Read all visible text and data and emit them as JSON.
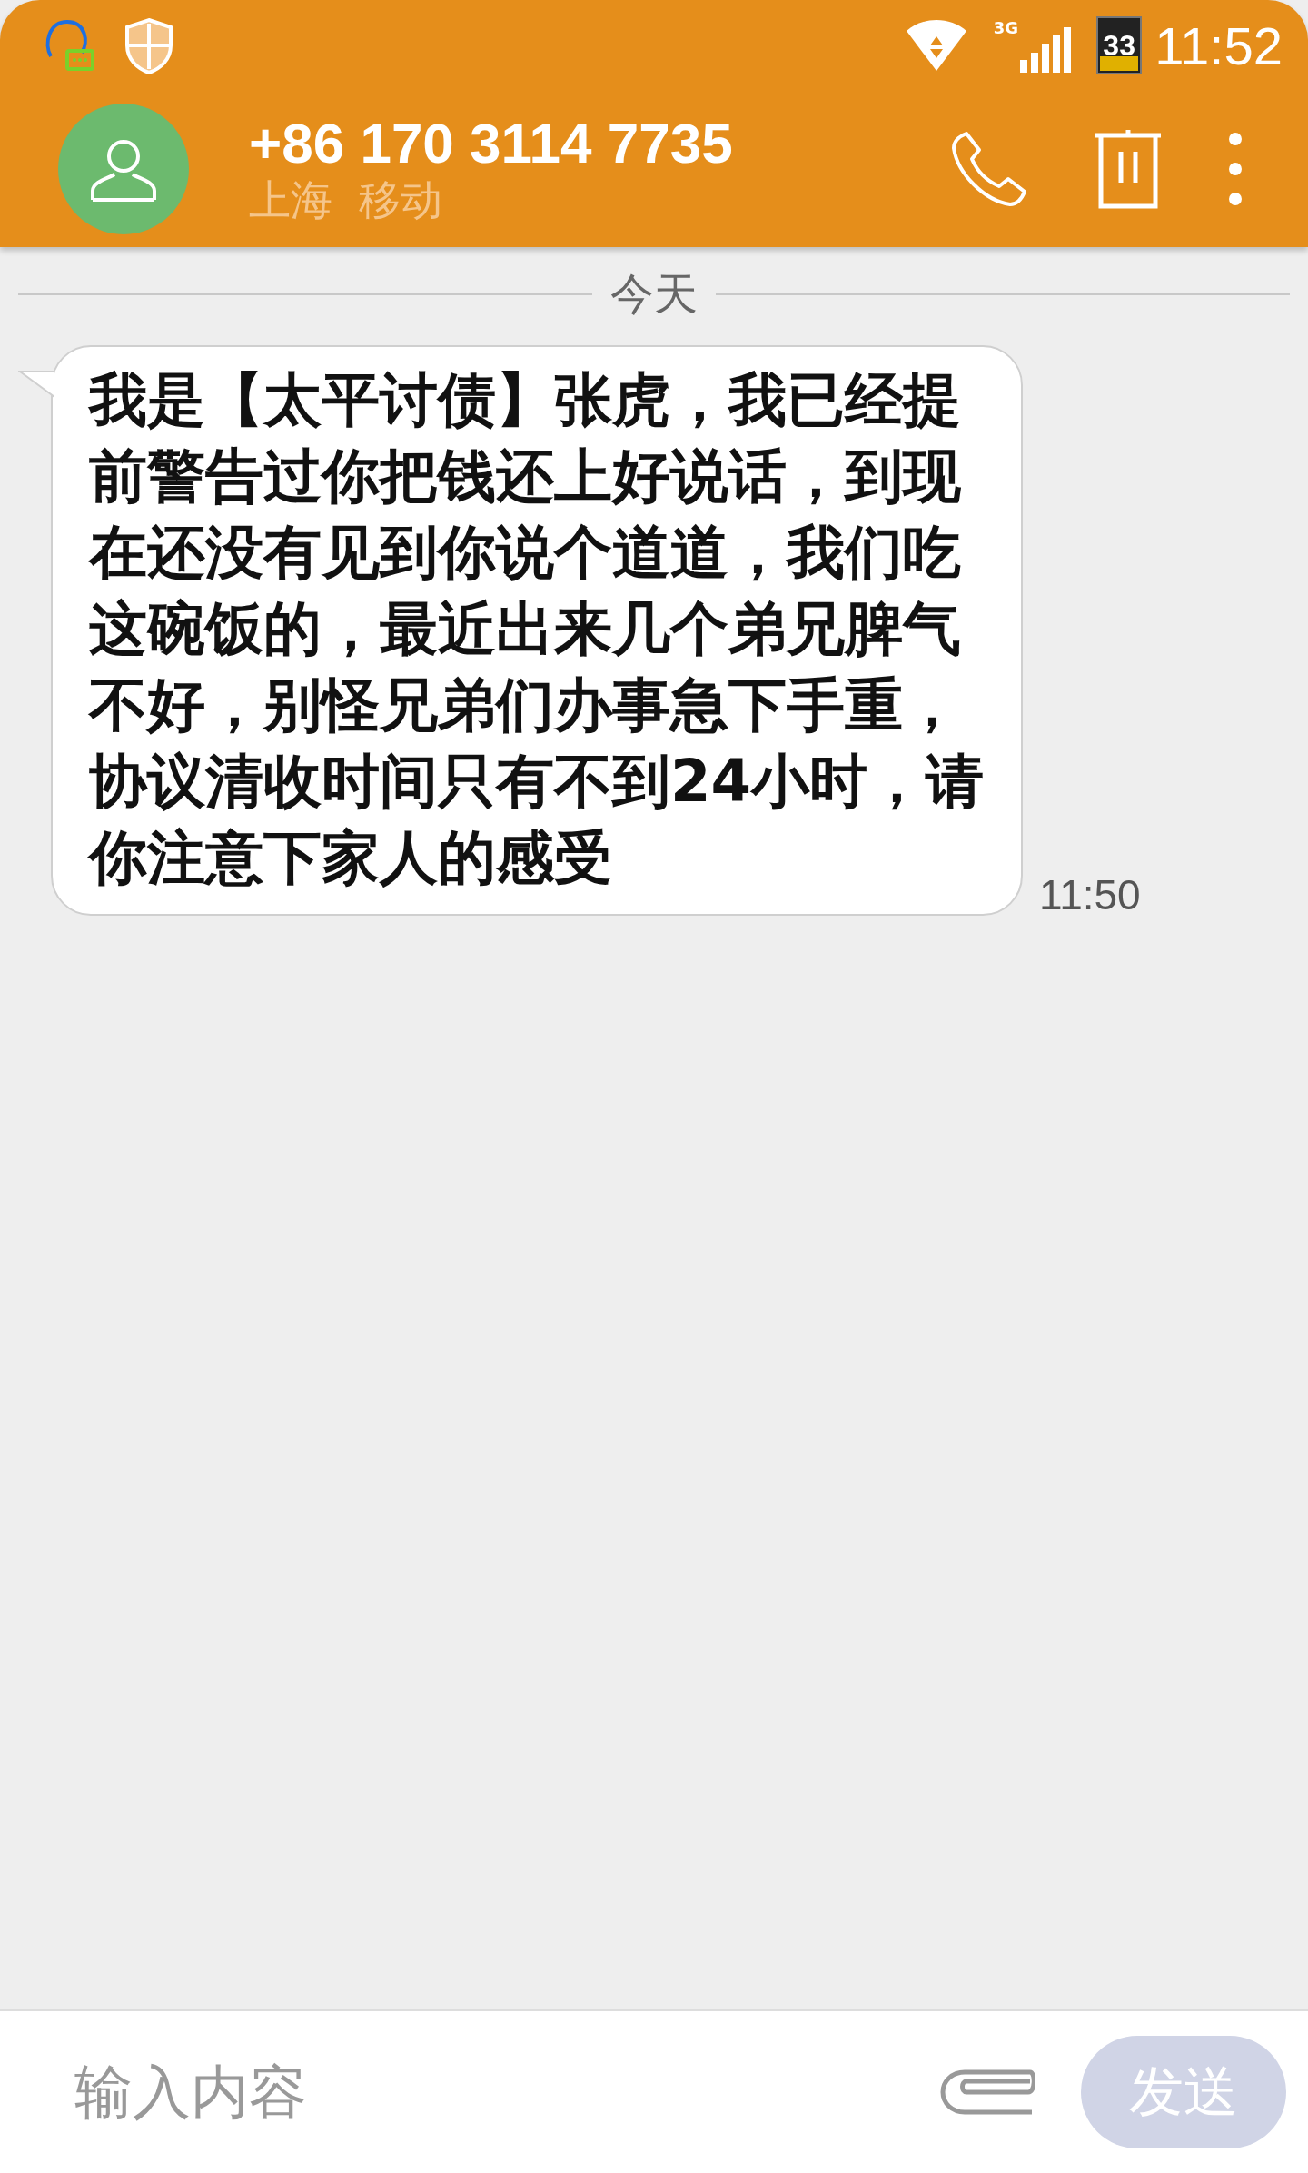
{
  "status_bar": {
    "network": "3G",
    "battery": "33",
    "time": "11:52"
  },
  "header": {
    "title": "+86 170 3114 7735",
    "subtitle": "上海  移动"
  },
  "date_divider": "今天",
  "messages": [
    {
      "text": "我是【太平讨债】张虎，我已经提前警告过你把钱还上好说话，到现在还没有见到你说个道道，我们吃这碗饭的，最近出来几个弟兄脾气不好，别怪兄弟们办事急下手重，协议清收时间只有不到24小时，请你注意下家人的感受",
      "time": "11:50"
    }
  ],
  "composer": {
    "placeholder": "输入内容",
    "send": "发送",
    "send_disabled": true
  }
}
